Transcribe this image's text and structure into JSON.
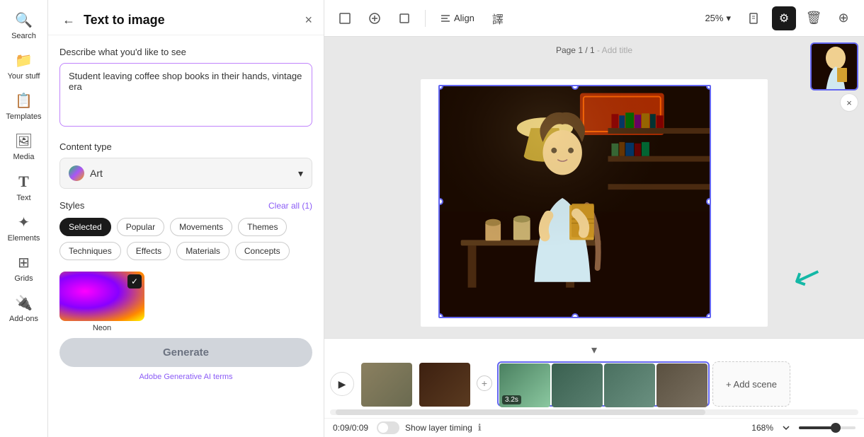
{
  "app": {
    "title": "Text to image"
  },
  "sidebar": {
    "items": [
      {
        "id": "search",
        "label": "Search",
        "icon": "🔍"
      },
      {
        "id": "your-stuff",
        "label": "Your stuff",
        "icon": "📁"
      },
      {
        "id": "templates",
        "label": "Templates",
        "icon": "📋"
      },
      {
        "id": "media",
        "label": "Media",
        "icon": "🖼"
      },
      {
        "id": "text",
        "label": "Text",
        "icon": "T"
      },
      {
        "id": "elements",
        "label": "Elements",
        "icon": "✦"
      },
      {
        "id": "grids",
        "label": "Grids",
        "icon": "⊞"
      },
      {
        "id": "add-ons",
        "label": "Add-ons",
        "icon": "🔌"
      }
    ]
  },
  "panel": {
    "back_label": "←",
    "title": "Text to image",
    "close_label": "×",
    "describe_label": "Describe what you'd like to see",
    "textarea_value": "Student leaving coffee shop books in their hands, vintage era",
    "content_type_label": "Content type",
    "content_type_value": "Art",
    "styles_label": "Styles",
    "clear_all_label": "Clear all (1)",
    "style_tags": [
      {
        "id": "selected",
        "label": "Selected",
        "active": true
      },
      {
        "id": "popular",
        "label": "Popular",
        "active": false
      },
      {
        "id": "movements",
        "label": "Movements",
        "active": false
      },
      {
        "id": "themes",
        "label": "Themes",
        "active": false
      },
      {
        "id": "techniques",
        "label": "Techniques",
        "active": false
      },
      {
        "id": "effects",
        "label": "Effects",
        "active": false
      },
      {
        "id": "materials",
        "label": "Materials",
        "active": false
      },
      {
        "id": "concepts",
        "label": "Concepts",
        "active": false
      }
    ],
    "style_items": [
      {
        "id": "neon",
        "name": "Neon",
        "checked": true
      }
    ],
    "generate_label": "Generate",
    "ai_terms_label": "Adobe Generative AI terms"
  },
  "toolbar": {
    "zoom_value": "25%",
    "align_label": "Align"
  },
  "canvas": {
    "page_label": "Page 1 / 1",
    "add_title_label": "- Add title"
  },
  "timeline": {
    "time_display": "0:09/0:09",
    "layer_timing_label": "Show layer timing",
    "zoom_value": "168%",
    "add_scene_label": "+ Add scene",
    "scene_duration": "3.2s"
  }
}
